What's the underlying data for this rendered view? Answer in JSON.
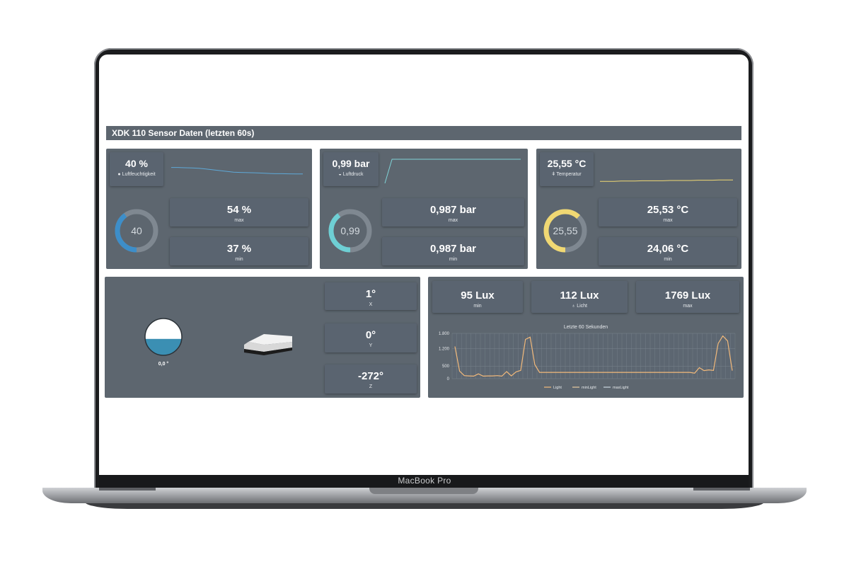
{
  "device": {
    "brand_label": "MacBook Pro"
  },
  "dashboard": {
    "title": "XDK 110 Sensor Daten (letzten 60s)",
    "humidity": {
      "value": "40 %",
      "label": "Luftfeuchtigkeit",
      "gauge": "40",
      "gauge_fraction": 0.4,
      "max_value": "54 %",
      "max_label": "max",
      "min_value": "37 %",
      "min_label": "min",
      "accent": "#3d8ec9",
      "icon": "droplet-icon"
    },
    "pressure": {
      "value": "0,99 bar",
      "label": "Luftdruck",
      "gauge": "0,99",
      "gauge_fraction": 0.4,
      "max_value": "0,987 bar",
      "max_label": "max",
      "min_value": "0,987 bar",
      "min_label": "min",
      "accent": "#6ecfd4",
      "icon": "gauge-icon"
    },
    "temperature": {
      "value": "25,55 °C",
      "label": "Temperatur",
      "gauge": "25,55",
      "gauge_fraction": 0.62,
      "max_value": "25,53 °C",
      "max_label": "max",
      "min_value": "24,06 °C",
      "min_label": "min",
      "accent": "#f0d873",
      "icon": "thermometer-icon"
    },
    "orientation": {
      "level_value": "0,0 °",
      "level_fraction": 0.45,
      "level_color": "#3b8fb3",
      "x_value": "1°",
      "x_label": "X",
      "y_value": "0°",
      "y_label": "Y",
      "z_value": "-272°",
      "z_label": "Z"
    },
    "light": {
      "min_value": "95 Lux",
      "min_label": "min",
      "current_value": "112 Lux",
      "current_label": "Licht",
      "current_icon": "lightbulb-icon",
      "max_value": "1769 Lux",
      "max_label": "max",
      "chart_title": "Letzte 60 Sekunden"
    }
  },
  "chart_data": {
    "type": "line",
    "title": "Letzte 60 Sekunden",
    "xlabel": "",
    "ylabel": "",
    "ylim": [
      0,
      1800
    ],
    "yticks": [
      "0",
      "500",
      "1.200",
      "1.800"
    ],
    "grid": true,
    "legend": "bottom",
    "series": [
      {
        "name": "Light",
        "color": "#f2b97a",
        "x": [
          0,
          1,
          2,
          3,
          4,
          5,
          6,
          7,
          8,
          9,
          10,
          11,
          12,
          13,
          14,
          15,
          16,
          17,
          18,
          19,
          20,
          21,
          22,
          23,
          24,
          25,
          26,
          27,
          28,
          29,
          30,
          31,
          32,
          33,
          34,
          35,
          36,
          37,
          38,
          39,
          40,
          41,
          42,
          43,
          44,
          45,
          46,
          47,
          48,
          49,
          50,
          51,
          52,
          53,
          54,
          55,
          56,
          57,
          58,
          59
        ],
        "values": [
          1280,
          300,
          120,
          110,
          100,
          190,
          100,
          110,
          110,
          120,
          100,
          280,
          110,
          270,
          330,
          1560,
          1650,
          560,
          250,
          250,
          250,
          250,
          250,
          250,
          250,
          250,
          250,
          250,
          250,
          250,
          250,
          250,
          250,
          250,
          250,
          250,
          250,
          250,
          250,
          250,
          250,
          250,
          250,
          250,
          250,
          250,
          250,
          250,
          250,
          250,
          250,
          220,
          440,
          320,
          350,
          330,
          1400,
          1700,
          1500,
          320
        ]
      },
      {
        "name": "minLight",
        "color": "#e8c9a0",
        "values": []
      },
      {
        "name": "maxLight",
        "color": "#c9d6e0",
        "values": []
      }
    ]
  },
  "sparklines": {
    "humidity": [
      0.3,
      0.3,
      0.32,
      0.33,
      0.35,
      0.4,
      0.45,
      0.5,
      0.55,
      0.6,
      0.62,
      0.63,
      0.64,
      0.66,
      0.68,
      0.7,
      0.7,
      0.71,
      0.72,
      0.72
    ],
    "pressure": [
      0.05,
      0.9,
      0.9,
      0.9,
      0.9,
      0.9,
      0.9,
      0.9,
      0.9,
      0.9,
      0.9,
      0.9,
      0.9,
      0.9,
      0.9,
      0.9,
      0.9,
      0.9,
      0.9,
      0.9
    ],
    "temperature": [
      0.12,
      0.12,
      0.12,
      0.13,
      0.13,
      0.13,
      0.14,
      0.14,
      0.14,
      0.14,
      0.15,
      0.15,
      0.15,
      0.15,
      0.16,
      0.16,
      0.16,
      0.17,
      0.17,
      0.17
    ]
  }
}
